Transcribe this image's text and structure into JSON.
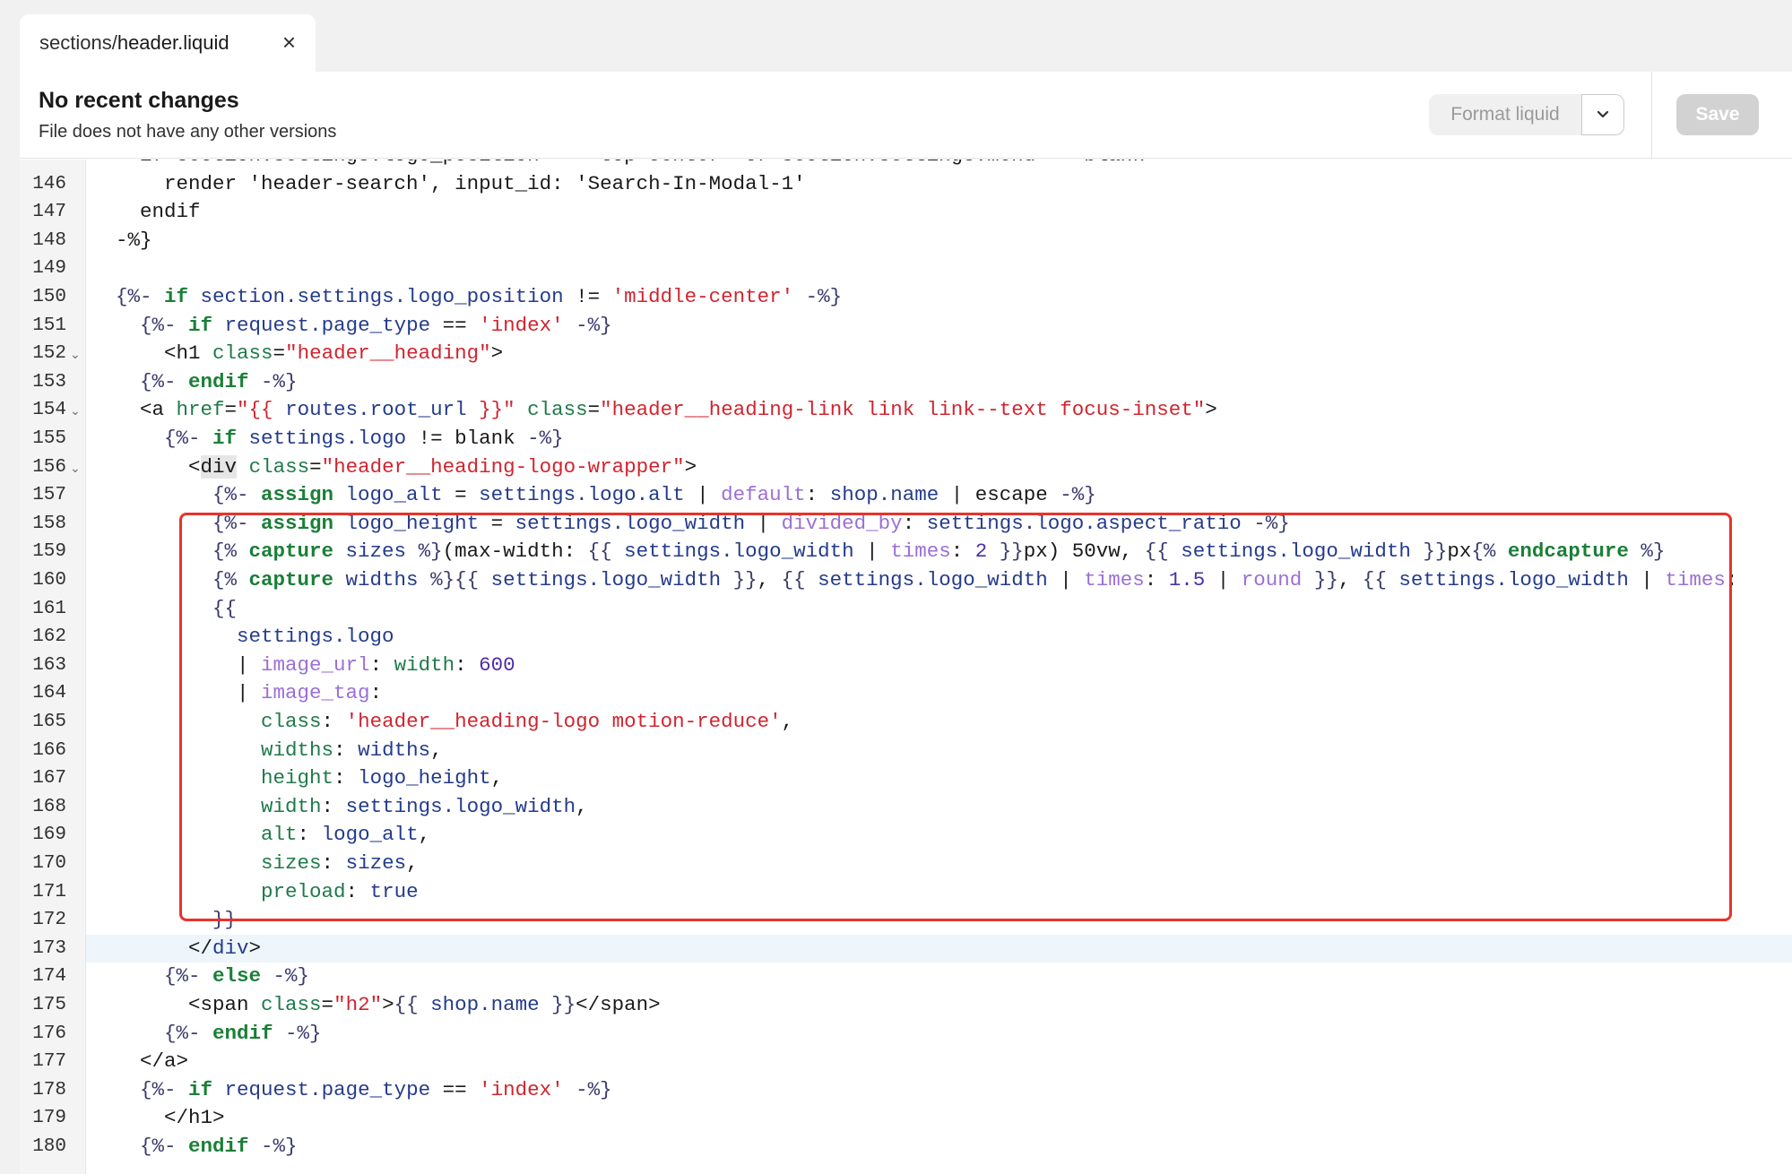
{
  "tab": {
    "path_prefix": "sections/",
    "path_file": "header.liquid",
    "close_glyph": "×"
  },
  "header": {
    "title": "No recent changes",
    "subtitle": "File does not have any other versions",
    "format_label": "Format liquid",
    "save_label": "Save"
  },
  "colors": {
    "highlight_border": "#e8332a",
    "keyword": "#1a7f37",
    "string": "#d1242f",
    "filter": "#9b6fd6"
  },
  "editor": {
    "lines": [
      {
        "n": "145",
        "fold": false,
        "segs": [
          [
            "t",
            "    if section.settings.logo_position == 'top-center' or section.settings.menu == blank"
          ]
        ]
      },
      {
        "n": "146",
        "fold": false,
        "segs": [
          [
            "t",
            "      render 'header-search', input_id: 'Search-In-Modal-1'"
          ]
        ]
      },
      {
        "n": "147",
        "fold": false,
        "segs": [
          [
            "t",
            "    endif"
          ]
        ]
      },
      {
        "n": "148",
        "fold": false,
        "segs": [
          [
            "t",
            "  -%}"
          ]
        ]
      },
      {
        "n": "149",
        "fold": false,
        "segs": []
      },
      {
        "n": "150",
        "fold": false,
        "segs": [
          [
            "d",
            "  {%- "
          ],
          [
            "k",
            "if"
          ],
          [
            "v",
            " section.settings.logo_position"
          ],
          [
            "t",
            " != "
          ],
          [
            "s",
            "'middle-center'"
          ],
          [
            "d",
            " -%}"
          ]
        ]
      },
      {
        "n": "151",
        "fold": false,
        "segs": [
          [
            "d",
            "    {%- "
          ],
          [
            "k",
            "if"
          ],
          [
            "v",
            " request.page_type"
          ],
          [
            "t",
            " == "
          ],
          [
            "s",
            "'index'"
          ],
          [
            "d",
            " -%}"
          ]
        ]
      },
      {
        "n": "152",
        "fold": true,
        "segs": [
          [
            "t",
            "      <h1 "
          ],
          [
            "a",
            "class"
          ],
          [
            "t",
            "="
          ],
          [
            "s",
            "\"header__heading\""
          ],
          [
            "t",
            ">"
          ]
        ]
      },
      {
        "n": "153",
        "fold": false,
        "segs": [
          [
            "d",
            "    {%- "
          ],
          [
            "k",
            "endif"
          ],
          [
            "d",
            " -%}"
          ]
        ]
      },
      {
        "n": "154",
        "fold": true,
        "segs": [
          [
            "t",
            "    <a "
          ],
          [
            "a",
            "href"
          ],
          [
            "t",
            "="
          ],
          [
            "s",
            "\"{{ "
          ],
          [
            "v",
            "routes.root_url"
          ],
          [
            "s",
            " }}\""
          ],
          [
            "t",
            " "
          ],
          [
            "a",
            "class"
          ],
          [
            "t",
            "="
          ],
          [
            "s",
            "\"header__heading-link link link--text focus-inset\""
          ],
          [
            "t",
            ">"
          ]
        ]
      },
      {
        "n": "155",
        "fold": false,
        "segs": [
          [
            "d",
            "      {%- "
          ],
          [
            "k",
            "if"
          ],
          [
            "v",
            " settings.logo"
          ],
          [
            "t",
            " != blank "
          ],
          [
            "d",
            "-%}"
          ]
        ]
      },
      {
        "n": "156",
        "fold": true,
        "segs": [
          [
            "t",
            "        <"
          ],
          [
            "hl",
            "div"
          ],
          [
            "t",
            " "
          ],
          [
            "a",
            "class"
          ],
          [
            "t",
            "="
          ],
          [
            "s",
            "\"header__heading-logo-wrapper\""
          ],
          [
            "t",
            ">"
          ]
        ]
      },
      {
        "n": "157",
        "fold": false,
        "segs": [
          [
            "d",
            "          {%- "
          ],
          [
            "k",
            "assign"
          ],
          [
            "v",
            " logo_alt"
          ],
          [
            "t",
            " = "
          ],
          [
            "v",
            "settings.logo.alt"
          ],
          [
            "t",
            " | "
          ],
          [
            "f",
            "default"
          ],
          [
            "t",
            ": "
          ],
          [
            "v",
            "shop.name"
          ],
          [
            "t",
            " | escape "
          ],
          [
            "d",
            "-%}"
          ]
        ]
      },
      {
        "n": "158",
        "fold": false,
        "segs": [
          [
            "d",
            "          {%- "
          ],
          [
            "k",
            "assign"
          ],
          [
            "v",
            " logo_height"
          ],
          [
            "t",
            " = "
          ],
          [
            "v",
            "settings.logo_width"
          ],
          [
            "t",
            " | "
          ],
          [
            "f",
            "divided_by"
          ],
          [
            "t",
            ": "
          ],
          [
            "v",
            "settings.logo.aspect_ratio"
          ],
          [
            "d",
            " -%}"
          ]
        ]
      },
      {
        "n": "159",
        "fold": false,
        "segs": [
          [
            "d",
            "          {% "
          ],
          [
            "k",
            "capture"
          ],
          [
            "v",
            " sizes"
          ],
          [
            "d",
            " %}"
          ],
          [
            "t",
            "(max-width: "
          ],
          [
            "d",
            "{{ "
          ],
          [
            "v",
            "settings.logo_width"
          ],
          [
            "t",
            " | "
          ],
          [
            "f",
            "times"
          ],
          [
            "t",
            ": "
          ],
          [
            "n",
            "2"
          ],
          [
            "d",
            " }}"
          ],
          [
            "t",
            "px) 50vw, "
          ],
          [
            "d",
            "{{ "
          ],
          [
            "v",
            "settings.logo_width"
          ],
          [
            "d",
            " }}"
          ],
          [
            "t",
            "px"
          ],
          [
            "d",
            "{% "
          ],
          [
            "k",
            "endcapture"
          ],
          [
            "d",
            " %}"
          ]
        ]
      },
      {
        "n": "160",
        "fold": false,
        "segs": [
          [
            "d",
            "          {% "
          ],
          [
            "k",
            "capture"
          ],
          [
            "v",
            " widths"
          ],
          [
            "d",
            " %}{{ "
          ],
          [
            "v",
            "settings.logo_width"
          ],
          [
            "d",
            " }}"
          ],
          [
            "t",
            ", "
          ],
          [
            "d",
            "{{ "
          ],
          [
            "v",
            "settings.logo_width"
          ],
          [
            "t",
            " | "
          ],
          [
            "f",
            "times"
          ],
          [
            "t",
            ": "
          ],
          [
            "n",
            "1.5"
          ],
          [
            "t",
            " | "
          ],
          [
            "f",
            "round"
          ],
          [
            "d",
            " }}"
          ],
          [
            "t",
            ", "
          ],
          [
            "d",
            "{{ "
          ],
          [
            "v",
            "settings.logo_width"
          ],
          [
            "t",
            " | "
          ],
          [
            "f",
            "times"
          ],
          [
            "t",
            ":"
          ]
        ]
      },
      {
        "n": "161",
        "fold": false,
        "segs": [
          [
            "d",
            "          {{"
          ]
        ]
      },
      {
        "n": "162",
        "fold": false,
        "segs": [
          [
            "v",
            "            settings.logo"
          ]
        ]
      },
      {
        "n": "163",
        "fold": false,
        "segs": [
          [
            "t",
            "            | "
          ],
          [
            "f",
            "image_url"
          ],
          [
            "t",
            ": "
          ],
          [
            "a",
            "width"
          ],
          [
            "t",
            ": "
          ],
          [
            "n",
            "600"
          ]
        ]
      },
      {
        "n": "164",
        "fold": false,
        "segs": [
          [
            "t",
            "            | "
          ],
          [
            "f",
            "image_tag"
          ],
          [
            "t",
            ":"
          ]
        ]
      },
      {
        "n": "165",
        "fold": false,
        "segs": [
          [
            "a",
            "              class"
          ],
          [
            "t",
            ": "
          ],
          [
            "s",
            "'header__heading-logo motion-reduce'"
          ],
          [
            "t",
            ","
          ]
        ]
      },
      {
        "n": "166",
        "fold": false,
        "segs": [
          [
            "a",
            "              widths"
          ],
          [
            "t",
            ": "
          ],
          [
            "v",
            "widths"
          ],
          [
            "t",
            ","
          ]
        ]
      },
      {
        "n": "167",
        "fold": false,
        "segs": [
          [
            "a",
            "              height"
          ],
          [
            "t",
            ": "
          ],
          [
            "v",
            "logo_height"
          ],
          [
            "t",
            ","
          ]
        ]
      },
      {
        "n": "168",
        "fold": false,
        "segs": [
          [
            "a",
            "              width"
          ],
          [
            "t",
            ": "
          ],
          [
            "v",
            "settings.logo_width"
          ],
          [
            "t",
            ","
          ]
        ]
      },
      {
        "n": "169",
        "fold": false,
        "segs": [
          [
            "a",
            "              alt"
          ],
          [
            "t",
            ": "
          ],
          [
            "v",
            "logo_alt"
          ],
          [
            "t",
            ","
          ]
        ]
      },
      {
        "n": "170",
        "fold": false,
        "segs": [
          [
            "a",
            "              sizes"
          ],
          [
            "t",
            ": "
          ],
          [
            "v",
            "sizes"
          ],
          [
            "t",
            ","
          ]
        ]
      },
      {
        "n": "171",
        "fold": false,
        "segs": [
          [
            "a",
            "              preload"
          ],
          [
            "t",
            ": "
          ],
          [
            "v",
            "true"
          ]
        ]
      },
      {
        "n": "172",
        "fold": false,
        "segs": [
          [
            "d",
            "          }}"
          ]
        ]
      },
      {
        "n": "173",
        "fold": false,
        "active": true,
        "segs": [
          [
            "t",
            "        </"
          ],
          [
            "v",
            "div"
          ],
          [
            "t",
            ">"
          ]
        ]
      },
      {
        "n": "174",
        "fold": false,
        "segs": [
          [
            "d",
            "      {%- "
          ],
          [
            "k",
            "else"
          ],
          [
            "d",
            " -%}"
          ]
        ]
      },
      {
        "n": "175",
        "fold": false,
        "segs": [
          [
            "t",
            "        <span "
          ],
          [
            "a",
            "class"
          ],
          [
            "t",
            "="
          ],
          [
            "s",
            "\"h2\""
          ],
          [
            "t",
            ">"
          ],
          [
            "d",
            "{{ "
          ],
          [
            "v",
            "shop.name"
          ],
          [
            "d",
            " }}"
          ],
          [
            "t",
            "</span>"
          ]
        ]
      },
      {
        "n": "176",
        "fold": false,
        "segs": [
          [
            "d",
            "      {%- "
          ],
          [
            "k",
            "endif"
          ],
          [
            "d",
            " -%}"
          ]
        ]
      },
      {
        "n": "177",
        "fold": false,
        "segs": [
          [
            "t",
            "    </a>"
          ]
        ]
      },
      {
        "n": "178",
        "fold": false,
        "segs": [
          [
            "d",
            "    {%- "
          ],
          [
            "k",
            "if"
          ],
          [
            "v",
            " request.page_type"
          ],
          [
            "t",
            " == "
          ],
          [
            "s",
            "'index'"
          ],
          [
            "d",
            " -%}"
          ]
        ]
      },
      {
        "n": "179",
        "fold": false,
        "segs": [
          [
            "t",
            "      </h1>"
          ]
        ]
      },
      {
        "n": "180",
        "fold": false,
        "segs": [
          [
            "d",
            "    {%- "
          ],
          [
            "k",
            "endif"
          ],
          [
            "d",
            " -%}"
          ]
        ]
      }
    ]
  }
}
